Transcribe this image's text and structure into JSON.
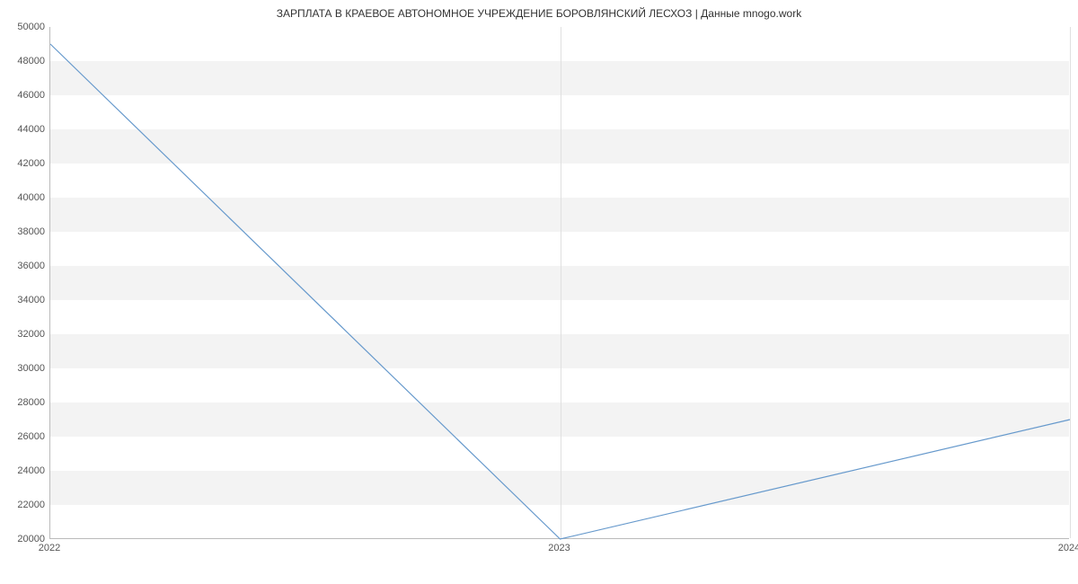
{
  "chart_data": {
    "type": "line",
    "title": "ЗАРПЛАТА В КРАЕВОЕ АВТОНОМНОЕ УЧРЕЖДЕНИЕ БОРОВЛЯНСКИЙ ЛЕСХОЗ | Данные mnogo.work",
    "xlabel": "",
    "ylabel": "",
    "x_ticks": [
      "2022",
      "2023",
      "2024"
    ],
    "y_ticks": [
      20000,
      22000,
      24000,
      26000,
      28000,
      30000,
      32000,
      34000,
      36000,
      38000,
      40000,
      42000,
      44000,
      46000,
      48000,
      50000
    ],
    "ylim": [
      20000,
      50000
    ],
    "xlim": [
      2022,
      2024
    ],
    "series": [
      {
        "name": "salary",
        "x": [
          2022,
          2023,
          2024
        ],
        "values": [
          49000,
          20000,
          27000
        ],
        "color": "#6699cc"
      }
    ]
  }
}
